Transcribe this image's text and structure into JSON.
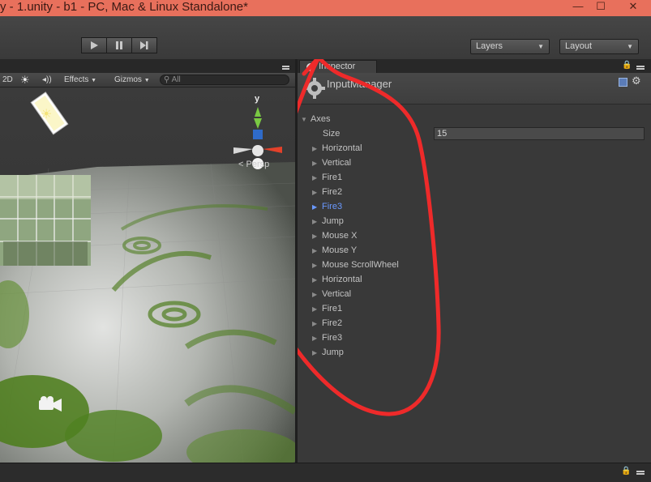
{
  "window": {
    "title": "y - 1.unity - b1 - PC, Mac & Linux Standalone*",
    "min_glyph": "—",
    "max_glyph": "☐",
    "close_glyph": "✕"
  },
  "toolbar": {
    "layers_label": "Layers",
    "layout_label": "Layout"
  },
  "scene": {
    "mode_2d": "2D",
    "effects_label": "Effects",
    "gizmos_label": "Gizmos",
    "search_placeholder": "All",
    "persp_label": "Persp",
    "gizmo_axis_y": "y"
  },
  "inspector": {
    "tab_label": "Inspector",
    "component_name": "InputManager",
    "axes_label": "Axes",
    "size_label": "Size",
    "size_value": "15",
    "axes_items": [
      "Horizontal",
      "Vertical",
      "Fire1",
      "Fire2",
      "Fire3",
      "Jump",
      "Mouse X",
      "Mouse Y",
      "Mouse ScrollWheel",
      "Horizontal",
      "Vertical",
      "Fire1",
      "Fire2",
      "Fire3",
      "Jump"
    ],
    "selected_index": 4
  },
  "colors": {
    "titlebar": "#e8705c",
    "selected_text": "#6a99ff",
    "annotation": "#ee2a2a",
    "gizmo_y": "#7ac943",
    "gizmo_x": "#e3412a"
  }
}
